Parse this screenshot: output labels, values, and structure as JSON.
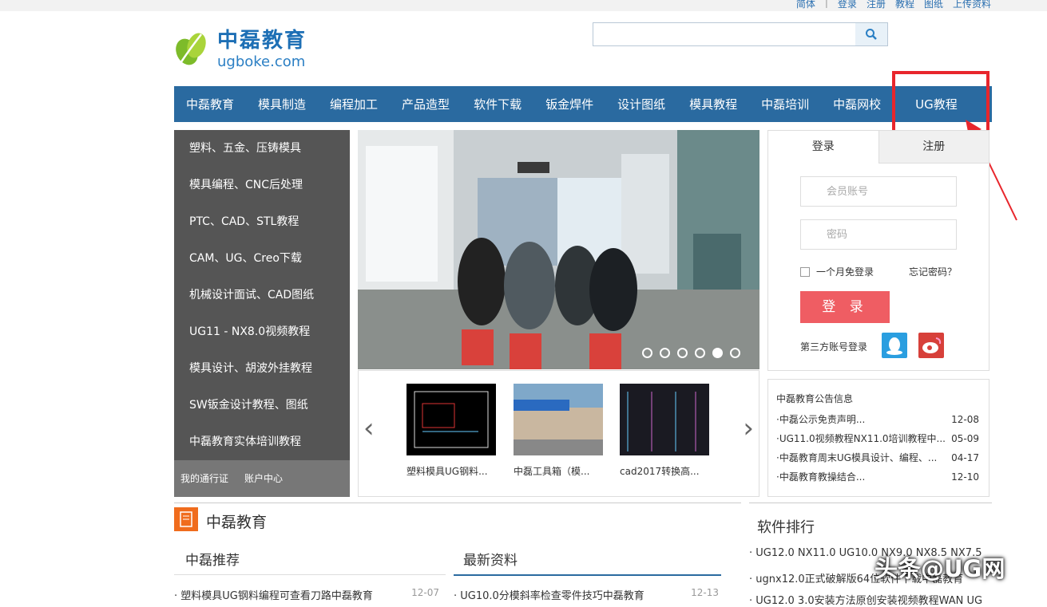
{
  "top_links": {
    "lang": "简体",
    "sep": "|",
    "login": "登录",
    "register": "注册",
    "tutorials": "教程",
    "drawings": "图纸",
    "upload": "上传资料"
  },
  "logo": {
    "cn": "中磊教育",
    "en": "ugboke.com"
  },
  "search": {
    "placeholder": "",
    "icon": "search-icon"
  },
  "nav": [
    "中磊教育",
    "模具制造",
    "编程加工",
    "产品造型",
    "软件下载",
    "钣金焊件",
    "设计图纸",
    "模具教程",
    "中磊培训",
    "中磊网校",
    "UG教程"
  ],
  "sidebar": {
    "items": [
      "塑料、五金、压铸模具",
      "模具编程、CNC后处理",
      "PTC、CAD、STL教程",
      "CAM、UG、Creo下载",
      "机械设计面试、CAD图纸",
      "UG11 - NX8.0视频教程",
      "模具设计、胡波外挂教程",
      "SW钣金设计教程、图纸",
      "中磊教育实体培训教程"
    ],
    "footer": [
      "我的通行证",
      "账户中心"
    ]
  },
  "banner": {
    "slides": 6,
    "active": 5
  },
  "thumbs": [
    {
      "caption": "塑料模具UG钢料..."
    },
    {
      "caption": "中磊工具箱（模..."
    },
    {
      "caption": "cad2017转换高..."
    }
  ],
  "login": {
    "tab_login": "登录",
    "tab_register": "注册",
    "account_placeholder": "会员账号",
    "password_placeholder": "密码",
    "remember": "一个月免登录",
    "forgot": "忘记密码？",
    "button": "登 录",
    "third_party": "第三方账号登录"
  },
  "notice": {
    "title": "中磊教育公告信息",
    "items": [
      {
        "text": "·中磊公示免责声明...",
        "date": "12-08"
      },
      {
        "text": "·UG11.0视频教程NX11.0培训教程中...",
        "date": "05-09"
      },
      {
        "text": "·中磊教育周末UG模具设计、编程、...",
        "date": "04-17"
      },
      {
        "text": "·中磊教育教操结合...",
        "date": "12-10"
      }
    ]
  },
  "section": {
    "title": "中磊教育",
    "recommend": "中磊推荐",
    "latest": "最新资料"
  },
  "recommend_list": [
    {
      "text": "· 塑料模具UG钢料编程可查看刀路中磊教育",
      "date": "12-07"
    }
  ],
  "latest_list": [
    {
      "text": "· UG10.0分模斜率检查零件技巧中磊教育",
      "date": "12-13"
    }
  ],
  "ranking": {
    "title": "软件排行",
    "items": [
      "· UG12.0 NX11.0 UG10.0 NX9.0 NX8.5 NX7.5",
      "· ugnx12.0正式破解版64位软件下载中磊教育",
      "· UG12.0 3.0安装方法原创安装视频教程WAN UG"
    ]
  },
  "watermark": "头条@UG网",
  "colors": {
    "nav": "#2a6aa0",
    "sidebar": "#555555",
    "login_button": "#ef5d63",
    "highlight": "#e8262c"
  }
}
